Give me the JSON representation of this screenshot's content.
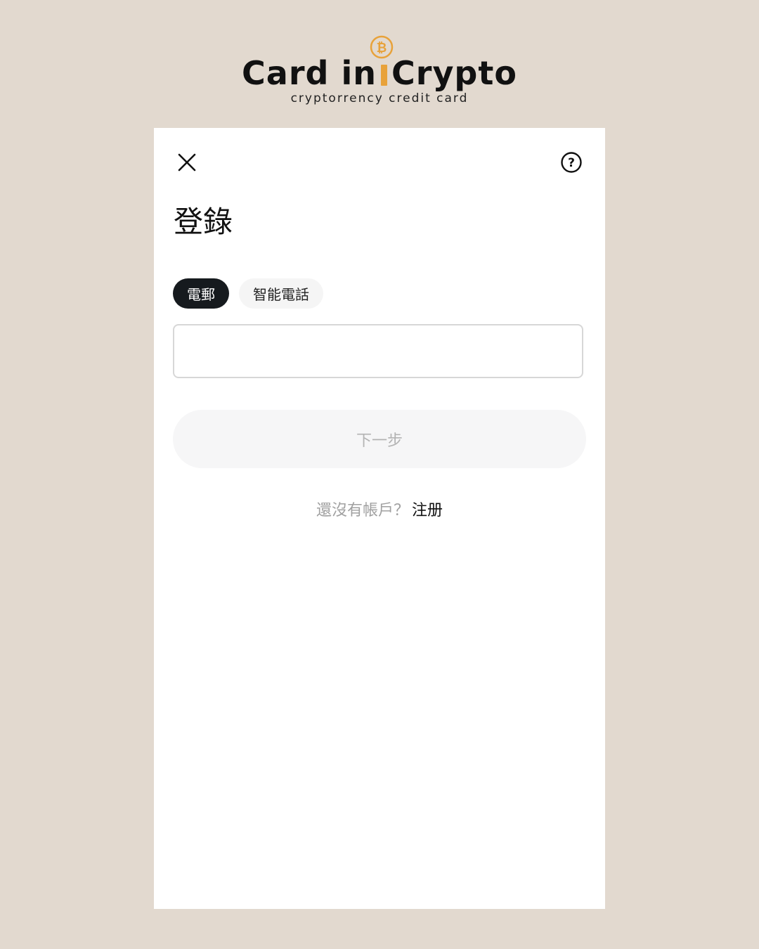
{
  "logo": {
    "title_left": "Card in",
    "title_right": "Crypto",
    "subtitle": "cryptorrency credit card",
    "coin_icon": "bitcoin-icon",
    "accent_color": "#e8a23a"
  },
  "header": {
    "close_icon": "close-icon",
    "help_icon": "help-icon"
  },
  "page": {
    "title": "登錄"
  },
  "tabs": [
    {
      "label": "電郵",
      "active": true
    },
    {
      "label": "智能電話",
      "active": false
    }
  ],
  "form": {
    "input_value": "",
    "input_placeholder": "",
    "next_label": "下一步"
  },
  "footer": {
    "prompt": "還沒有帳戶？",
    "signup_label": "注册"
  }
}
